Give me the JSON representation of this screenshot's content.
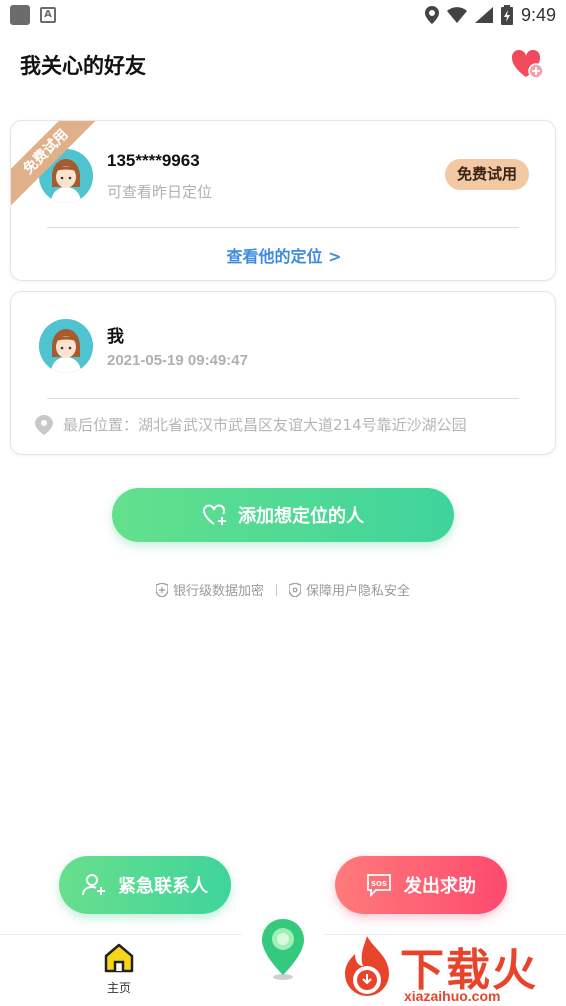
{
  "status_bar": {
    "time": "9:49"
  },
  "header": {
    "title": "我关心的好友"
  },
  "friend_card": {
    "ribbon": "免费试用",
    "phone": "135****9963",
    "subtitle": "可查看昨日定位",
    "badge": "免费试用",
    "link": "查看他的定位 >"
  },
  "me_card": {
    "name": "我",
    "timestamp": "2021-05-19 09:49:47",
    "location": "最后位置：湖北省武汉市武昌区友谊大道214号靠近沙湖公园"
  },
  "add_button": {
    "label": "添加想定位的人"
  },
  "security": {
    "item1": "银行级数据加密",
    "item2": "保障用户隐私安全"
  },
  "fabs": {
    "contact": "紧急联系人",
    "sos": "发出求助",
    "sos_icon_text": "SOS"
  },
  "bottom_nav": {
    "home": "主页"
  },
  "watermark": {
    "brand": "下载火",
    "url": "xiazaihuo.com"
  },
  "colors": {
    "green": "#3fd49c",
    "red": "#fd4a6e",
    "link_blue": "#3f8be0",
    "badge": "#f3c9a3"
  }
}
